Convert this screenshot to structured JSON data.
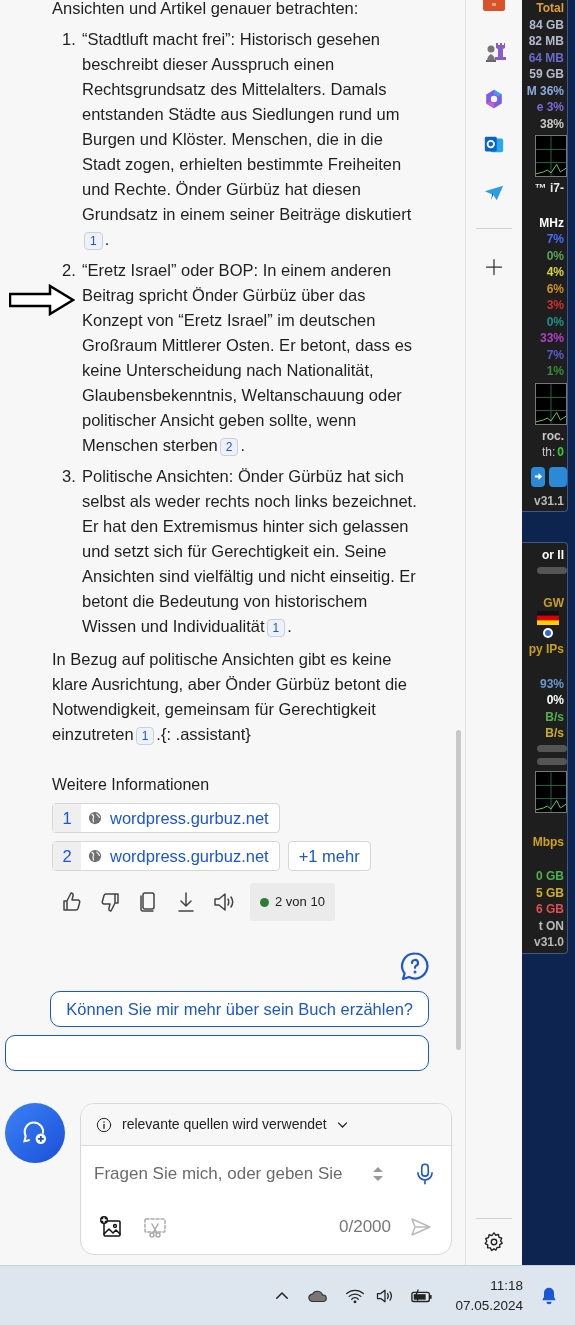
{
  "intro": "Ansichten und Artikel genauer betrachten:",
  "points": [
    {
      "number": "1.",
      "text": "“Stadtluft macht frei”: Historisch gesehen beschreibt dieser Ausspruch einen Rechtsgrundsatz des Mittelalters. Damals entstanden Städte aus Siedlungen rund um Burgen und Klöster. Menschen, die in die Stadt zogen, erhielten bestimmte Freiheiten und Rechte. Önder Gürbüz hat diesen Grundsatz in einem seiner Beiträge diskutiert",
      "citation": "1",
      "tail": "."
    },
    {
      "number": "2.",
      "text": "“Eretz Israel” oder BOP: In einem anderen Beitrag spricht Önder Gürbüz über das Konzept von “Eretz Israel” im deutschen Großraum Mittlerer Osten. Er betont, dass es keine Unterscheidung nach Nationalität, Glaubensbekenntnis, Weltanschauung oder politischer Ansicht geben sollte, wenn Menschen sterben",
      "citation": "2",
      "tail": "."
    },
    {
      "number": "3.",
      "text": "Politische Ansichten: Önder Gürbüz hat sich selbst als weder rechts noch links bezeichnet. Er hat den Extremismus hinter sich gelassen und setzt sich für Gerechtigkeit ein. Seine Ansichten sind vielfältig und nicht einseitig. Er betont die Bedeutung von historischem Wissen und Individualität",
      "citation": "1",
      "tail": "."
    }
  ],
  "summary": {
    "text": "In Bezug auf politische Ansichten gibt es keine klare Ausrichtung, aber Önder Gürbüz betont die Notwendigkeit, gemeinsam für Gerechtigkeit einzutreten",
    "citation": "1",
    "tail": ".{: .assistant}"
  },
  "sources": {
    "heading": "Weitere Informationen",
    "items": [
      {
        "number": "1",
        "domain": "wordpress.gurbuz.net"
      },
      {
        "number": "2",
        "domain": "wordpress.gurbuz.net"
      }
    ],
    "more": "+1 mehr"
  },
  "feedback": {
    "counter": "2 von 10"
  },
  "suggestions": [
    {
      "text": "Können Sie mir mehr über sein Buch erzählen?"
    },
    {
      "kind": "cut"
    }
  ],
  "input": {
    "notice": "relevante quellen wird verwendet",
    "placeholder": "Fragen Sie mich, oder geben Sie",
    "count": "0/2000"
  },
  "gadgets": [
    {
      "rows": [
        {
          "kind": "text",
          "text": "Total",
          "color": "#e0a030"
        },
        {
          "kind": "text",
          "text": "84 GB",
          "color": "#b8b8d0"
        },
        {
          "kind": "text",
          "text": "82 MB",
          "color": "#b8b8d0"
        },
        {
          "kind": "text",
          "text": "64 MB",
          "color": "#6a6ad0"
        },
        {
          "kind": "text",
          "text": "59 GB",
          "color": "#b8b8d0"
        },
        {
          "kind": "text",
          "text": "M 36%",
          "color": "#8aaae0"
        },
        {
          "kind": "text",
          "text": "e 3%",
          "color": "#7a6ad8"
        },
        {
          "kind": "text",
          "text": "38%",
          "color": "#c8c8c8"
        },
        {
          "kind": "graph"
        },
        {
          "kind": "text",
          "text": "™ i7-",
          "color": "#e8e8e8"
        },
        {
          "kind": "gap"
        },
        {
          "kind": "text",
          "text": "MHz",
          "color": "#ffffff"
        },
        {
          "kind": "text",
          "text": "7%",
          "color": "#4a6cff"
        },
        {
          "kind": "text",
          "text": "0%",
          "color": "#5fa05f"
        },
        {
          "kind": "text",
          "text": "4%",
          "color": "#d8d840"
        },
        {
          "kind": "text",
          "text": "6%",
          "color": "#d09020"
        },
        {
          "kind": "text",
          "text": "3%",
          "color": "#d03030"
        },
        {
          "kind": "text",
          "text": "0%",
          "color": "#20908a"
        },
        {
          "kind": "text",
          "text": "33%",
          "color": "#b040c8"
        },
        {
          "kind": "text",
          "text": "7%",
          "color": "#5a5ad0"
        },
        {
          "kind": "text",
          "text": "1%",
          "color": "#3a8a3a"
        },
        {
          "kind": "graph"
        },
        {
          "kind": "text",
          "text": "roc.",
          "color": "#c8c8c8"
        },
        {
          "kind": "pair",
          "text": "th:",
          "value": "0",
          "color": "#30d030"
        },
        {
          "kind": "buttons"
        },
        {
          "kind": "text",
          "text": "v31.1",
          "color": "#b8b8b8"
        }
      ]
    },
    {
      "rows": [
        {
          "kind": "text",
          "text": "or II",
          "color": "#ffffff"
        },
        {
          "kind": "bar"
        },
        {
          "kind": "gap"
        },
        {
          "kind": "text",
          "text": "GW",
          "color": "#c8a020"
        },
        {
          "kind": "flag"
        },
        {
          "kind": "radio"
        },
        {
          "kind": "text",
          "text": "py IPs",
          "color": "#c8a020"
        },
        {
          "kind": "gap"
        },
        {
          "kind": "text",
          "text": "93%",
          "color": "#6a9ad0"
        },
        {
          "kind": "text",
          "text": "0%",
          "color": "#ffffff"
        },
        {
          "kind": "text",
          "text": "B/s",
          "color": "#50b050"
        },
        {
          "kind": "text",
          "text": "B/s",
          "color": "#c8b020"
        },
        {
          "kind": "bar"
        },
        {
          "kind": "bar"
        },
        {
          "kind": "graph"
        },
        {
          "kind": "gap"
        },
        {
          "kind": "text",
          "text": "Mbps",
          "color": "#d0a020"
        },
        {
          "kind": "gap"
        },
        {
          "kind": "text",
          "text": "0 GB",
          "color": "#50b050"
        },
        {
          "kind": "text",
          "text": "5 GB",
          "color": "#d0b020"
        },
        {
          "kind": "text",
          "text": "6 GB",
          "color": "#e05050"
        },
        {
          "kind": "text",
          "text": "t ON",
          "color": "#b8b8b8"
        },
        {
          "kind": "text",
          "text": "v31.0",
          "color": "#b8b8b8"
        }
      ]
    }
  ],
  "taskbar": {
    "time": "11:18",
    "date": "07.05.2024"
  }
}
